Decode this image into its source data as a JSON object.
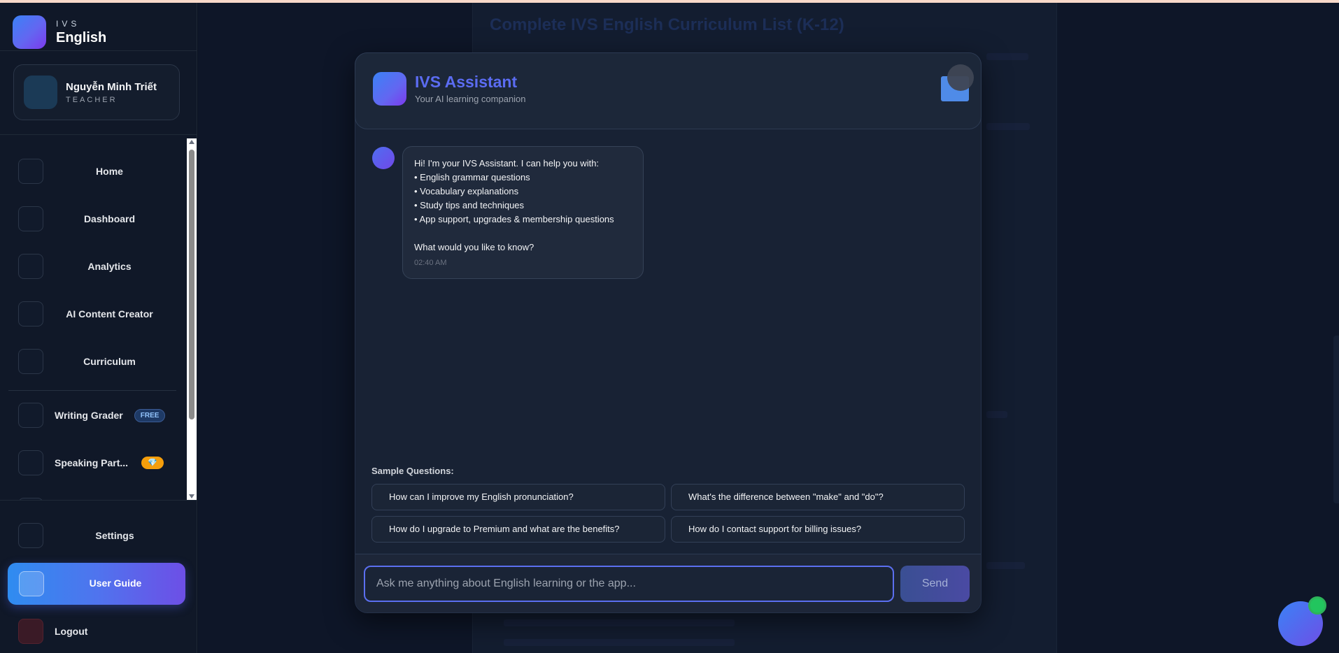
{
  "brand": {
    "small": "IVS",
    "name": "English"
  },
  "user": {
    "name": "Nguyễn Minh Triết",
    "role": "TEACHER"
  },
  "nav": {
    "home": "Home",
    "dashboard": "Dashboard",
    "analytics": "Analytics",
    "ai_content_creator": "AI Content Creator",
    "curriculum": "Curriculum",
    "writing_grader": "Writing Grader",
    "writing_grader_badge": "FREE",
    "speaking_practice": "Speaking Part...",
    "speaking_badge_icon": "gem-icon",
    "settings": "Settings",
    "user_guide": "User Guide",
    "logout": "Logout"
  },
  "background": {
    "title": "Complete IVS English Curriculum List (K-12)"
  },
  "assistant": {
    "title": "IVS Assistant",
    "subtitle": "Your AI learning companion",
    "message": {
      "intro": "Hi! I'm your IVS Assistant. I can help you with:",
      "bullets": [
        "• English grammar questions",
        "• Vocabulary explanations",
        "• Study tips and techniques",
        "• App support, upgrades & membership questions"
      ],
      "question": "What would you like to know?",
      "time": "02:40 AM"
    },
    "sample_label": "Sample Questions:",
    "samples": [
      "How can I improve my English pronunciation?",
      "What's the difference between \"make\" and \"do\"?",
      "How do I upgrade to Premium and what are the benefits?",
      "How do I contact support for billing issues?"
    ],
    "input_placeholder": "Ask me anything about English learning or the app...",
    "send_label": "Send"
  },
  "colors": {
    "accent": "#5b6cf2",
    "brand_gradient_start": "#3b82f6",
    "brand_gradient_end": "#7c3aed",
    "online_dot": "#22c55e",
    "premium_badge": "#f59e0b"
  }
}
